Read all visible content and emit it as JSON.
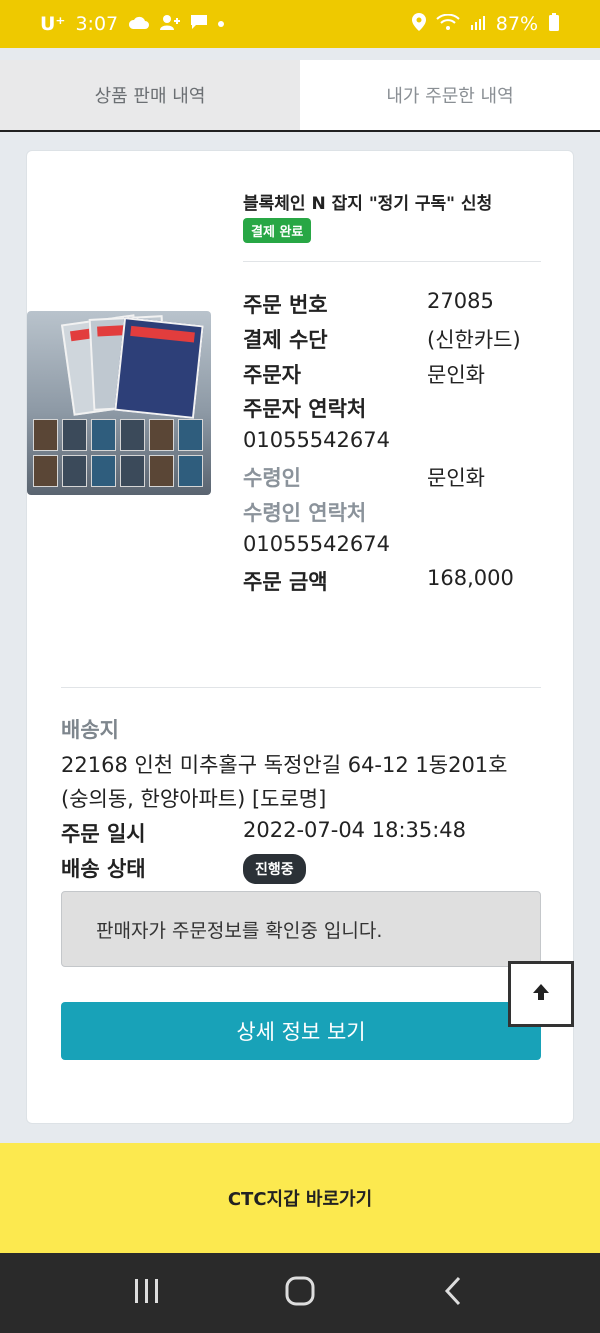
{
  "status_bar": {
    "carrier": "U⁺",
    "time": "3:07",
    "battery": "87%"
  },
  "tabs": [
    {
      "label": "상품 판매 내역",
      "active": true
    },
    {
      "label": "내가 주문한 내역",
      "active": false
    }
  ],
  "order": {
    "product_title": "블록체인 N 잡지 \"정기 구독\" 신청",
    "payment_status_badge": "결제 완료",
    "details": [
      {
        "label": "주문 번호",
        "value": "27085"
      },
      {
        "label": "결제 수단",
        "value": "(신한카드)"
      },
      {
        "label": "주문자",
        "value": "문인화"
      },
      {
        "label": "주문자 연락처",
        "value": "01055542674"
      },
      {
        "label": "수령인",
        "value": "문인화"
      },
      {
        "label": "수령인 연락처",
        "value": "01055542674"
      },
      {
        "label": "주문 금액",
        "value": "168,000"
      }
    ],
    "shipping_label": "배송지",
    "address_line1": "22168 인천 미추홀구 독정안길 64-12 1동201호",
    "address_line2": "(숭의동, 한양아파트) [도로명]",
    "order_date_label": "주문 일시",
    "order_date": "2022-07-04 18:35:48",
    "delivery_status_label": "배송 상태",
    "delivery_status_badge": "진행중",
    "notice": "판매자가 주문정보를 확인중 입니다.",
    "detail_button": "상세 정보 보기"
  },
  "wallet_link": "CTC지갑 바로가기",
  "colors": {
    "status_bar": "#eec900",
    "paid_badge": "#28a745",
    "detail_button": "#18a2b8",
    "wallet_bar": "#fce94f"
  }
}
